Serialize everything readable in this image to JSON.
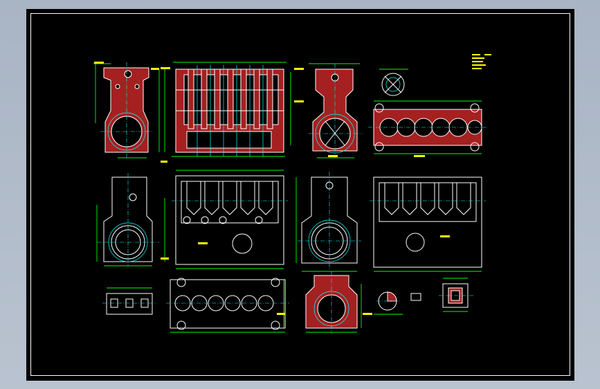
{
  "drawing": {
    "line_color": "#ffffff",
    "dimension_color": "#00ff00",
    "centerline_color": "#00ffff",
    "section_fill_color": "#a52020",
    "note_color": "#ffff00",
    "background_color": "#000000"
  },
  "views": [
    {
      "id": "end-section-left",
      "kind": "section"
    },
    {
      "id": "front-section",
      "kind": "section"
    },
    {
      "id": "end-section-right",
      "kind": "section"
    },
    {
      "id": "detail-circle",
      "kind": "detail"
    },
    {
      "id": "bottom-section",
      "kind": "section"
    },
    {
      "id": "end-view-left",
      "kind": "elevation"
    },
    {
      "id": "front-view-middle",
      "kind": "elevation"
    },
    {
      "id": "end-view-right",
      "kind": "elevation"
    },
    {
      "id": "rear-view",
      "kind": "elevation"
    },
    {
      "id": "small-section",
      "kind": "section"
    },
    {
      "id": "top-view",
      "kind": "plan"
    },
    {
      "id": "bearing-section",
      "kind": "section"
    },
    {
      "id": "small-details",
      "kind": "detail"
    },
    {
      "id": "right-detail",
      "kind": "detail"
    }
  ]
}
